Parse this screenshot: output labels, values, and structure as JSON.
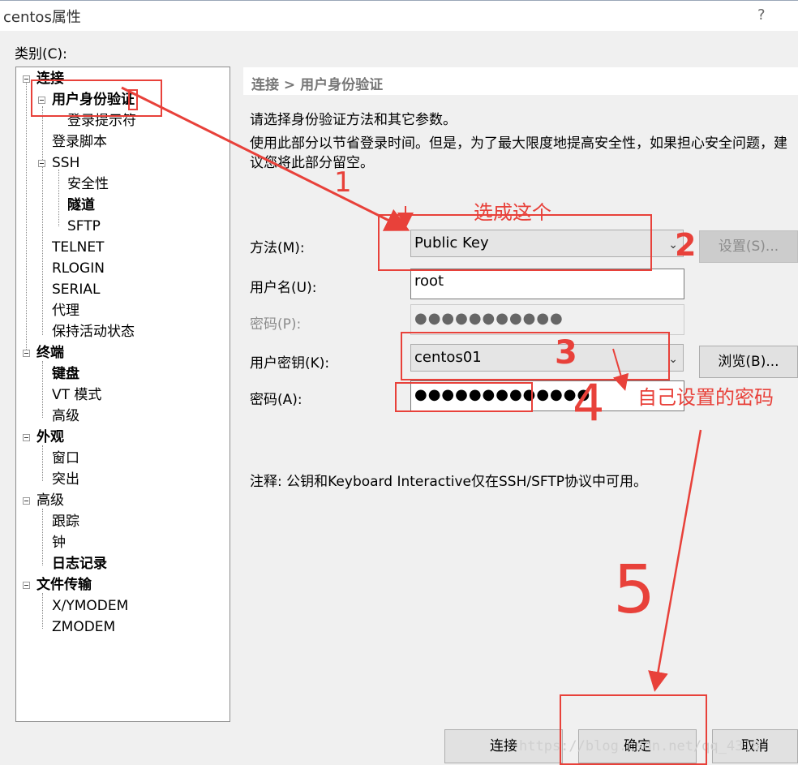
{
  "window": {
    "title": "centos属性",
    "help": "?"
  },
  "category_label": "类别(C):",
  "tree": [
    {
      "label": "连接",
      "bold": true
    },
    {
      "label": "用户身份验证",
      "bold": true
    },
    {
      "label": "登录提示符",
      "bold": false
    },
    {
      "label": "登录脚本",
      "bold": false
    },
    {
      "label": "SSH",
      "bold": false
    },
    {
      "label": "安全性",
      "bold": false
    },
    {
      "label": "隧道",
      "bold": true
    },
    {
      "label": "SFTP",
      "bold": false
    },
    {
      "label": "TELNET",
      "bold": false
    },
    {
      "label": "RLOGIN",
      "bold": false
    },
    {
      "label": "SERIAL",
      "bold": false
    },
    {
      "label": "代理",
      "bold": false
    },
    {
      "label": "保持活动状态",
      "bold": false
    },
    {
      "label": "终端",
      "bold": true
    },
    {
      "label": "键盘",
      "bold": true
    },
    {
      "label": "VT 模式",
      "bold": false
    },
    {
      "label": "高级",
      "bold": false
    },
    {
      "label": "外观",
      "bold": true
    },
    {
      "label": "窗口",
      "bold": false
    },
    {
      "label": "突出",
      "bold": false
    },
    {
      "label": "高级",
      "bold": false
    },
    {
      "label": "跟踪",
      "bold": false
    },
    {
      "label": "钟",
      "bold": false
    },
    {
      "label": "日志记录",
      "bold": true
    },
    {
      "label": "文件传输",
      "bold": true
    },
    {
      "label": "X/YMODEM",
      "bold": false
    },
    {
      "label": "ZMODEM",
      "bold": false
    }
  ],
  "panel": {
    "breadcrumb": "连接 > 用户身份验证",
    "desc1": "请选择身份验证方法和其它参数。",
    "desc2": "使用此部分以节省登录时间。但是，为了最大限度地提高安全性，如果担心安全问题，建议您将此部分留空。",
    "method_label": "方法(M):",
    "method_value": "Public Key",
    "settings_button": "设置(S)...",
    "username_label": "用户名(U):",
    "username_value": "root",
    "password_label": "密码(P):",
    "password_value": "●●●●●●●●●●●",
    "userkey_label": "用户密钥(K):",
    "userkey_value": "centos01",
    "browse_button": "浏览(B)...",
    "passphrase_label": "密码(A):",
    "passphrase_value": "●●●●●●●●●●●●●",
    "note": "注释: 公钥和Keyboard Interactive仅在SSH/SFTP协议中可用。"
  },
  "buttons": {
    "connect": "连接",
    "ok": "确定",
    "cancel": "取消"
  },
  "annotations": {
    "choose_this": "选成这个",
    "own_password": "自己设置的密码",
    "n1": "1",
    "n2": "2",
    "n3": "3",
    "n4": "4",
    "n5": "5",
    "color": "#e8413a"
  },
  "watermark": "https://blog.csdn.net/qq_4318"
}
